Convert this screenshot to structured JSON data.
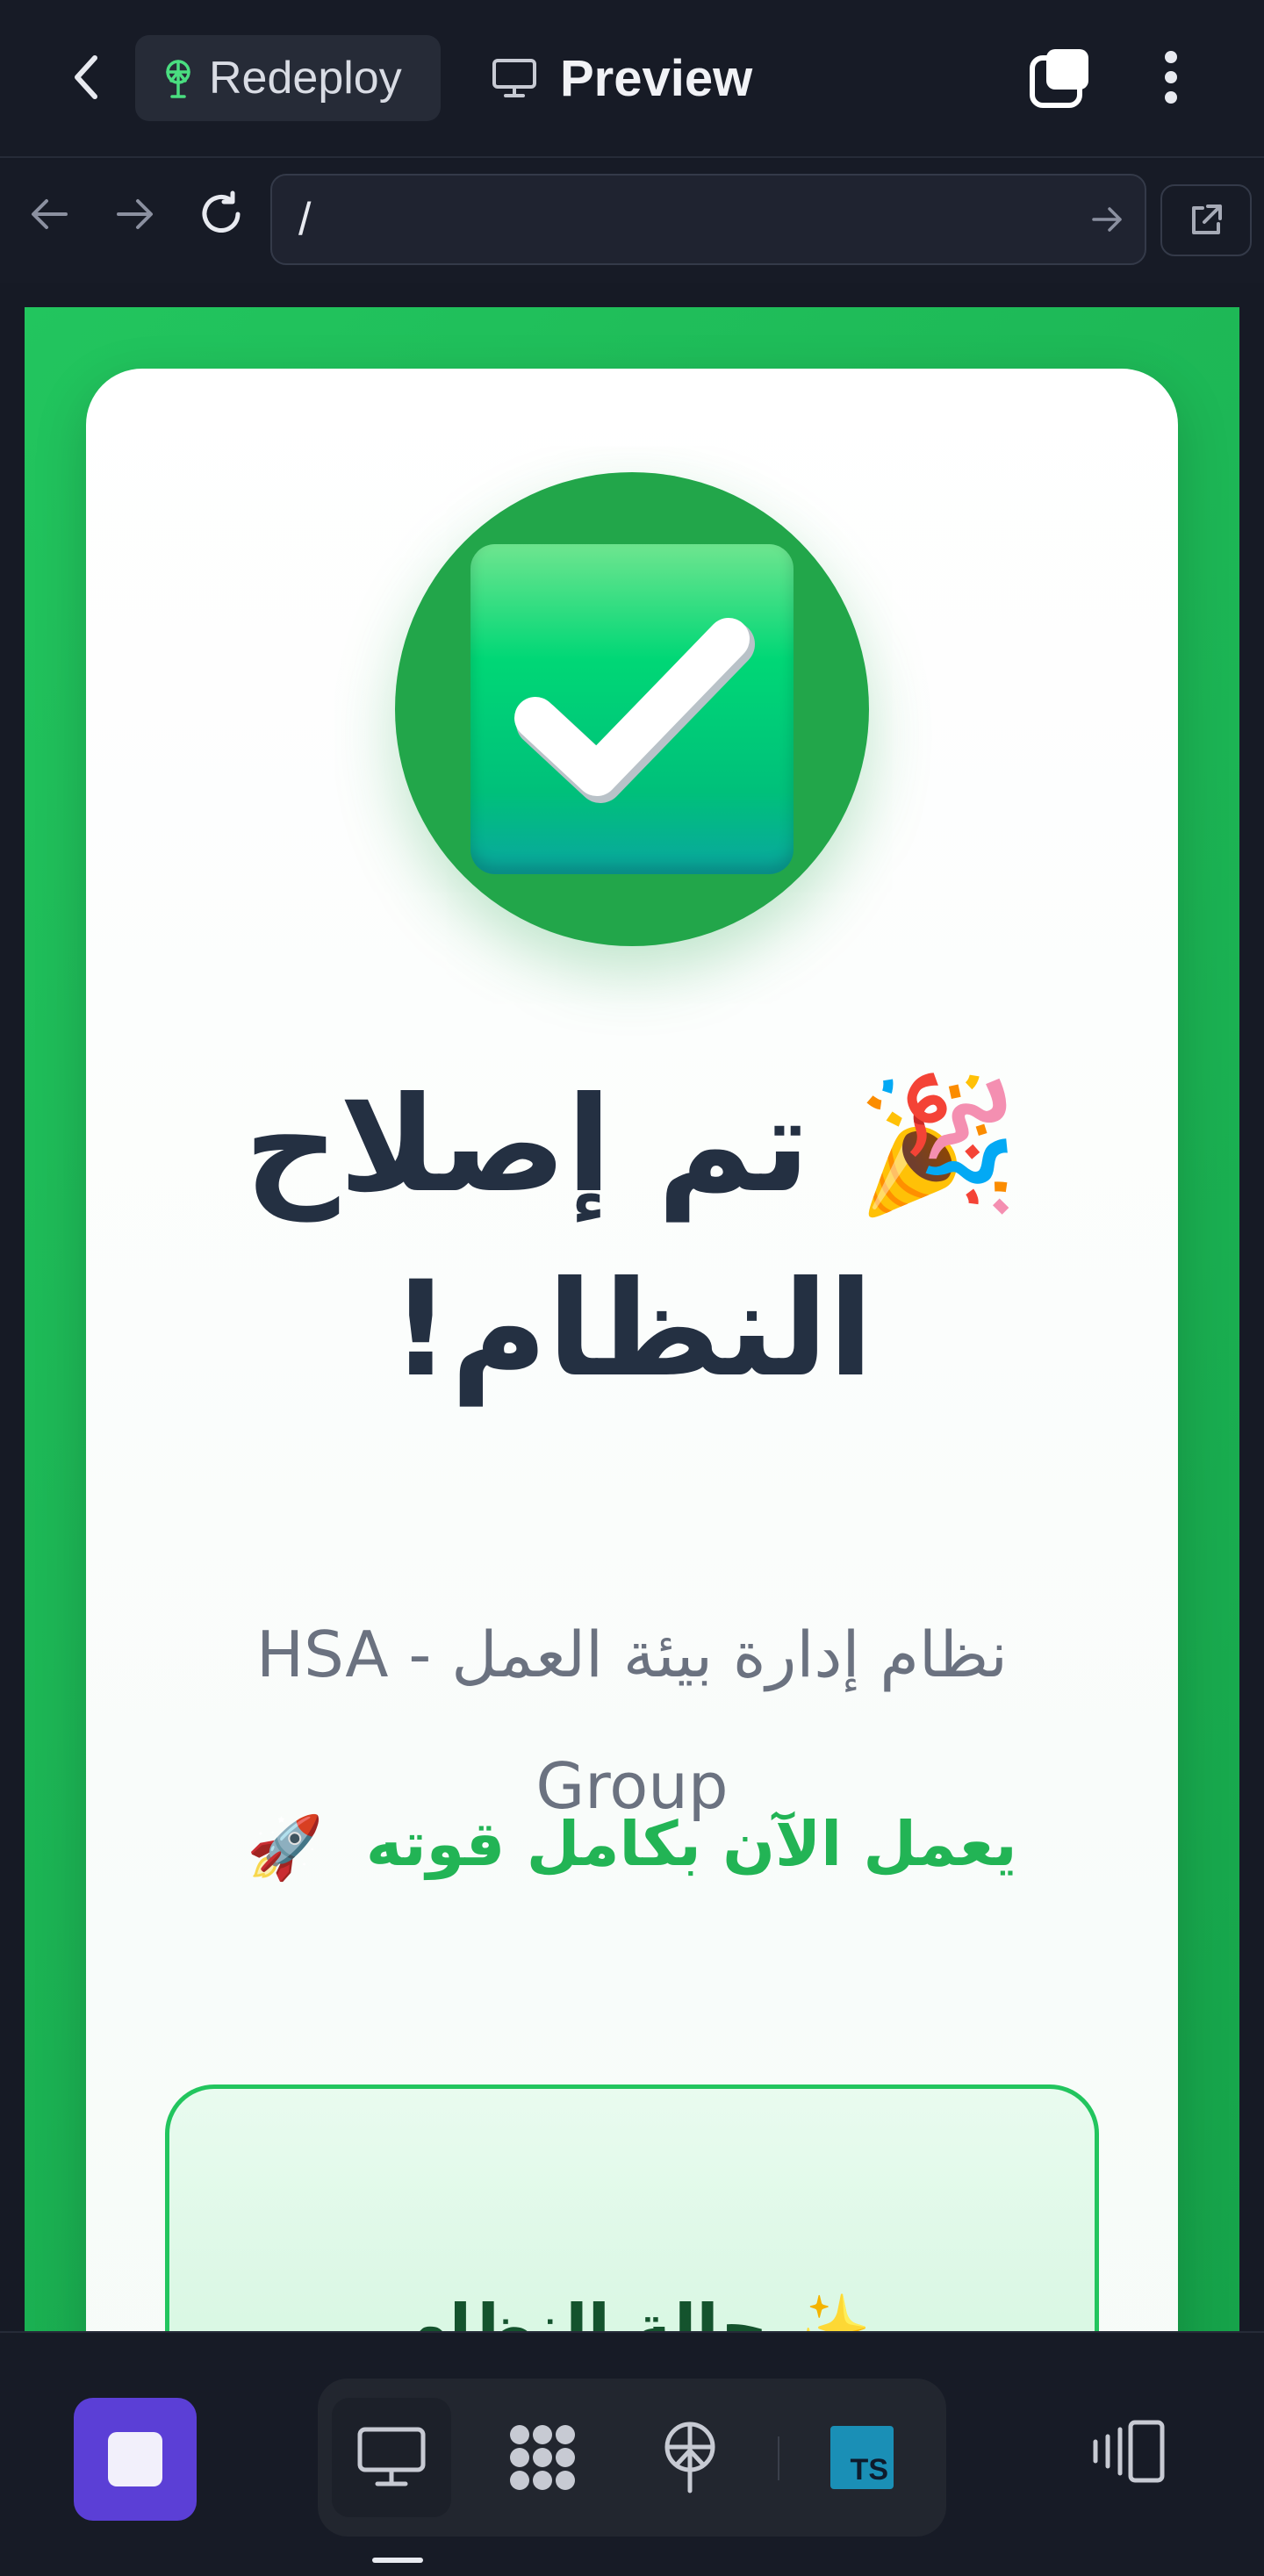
{
  "topbar": {
    "back_icon": "chevron-left-icon",
    "redeploy_label": "Redeploy",
    "redeploy_icon": "antenna-icon",
    "preview_label": "Preview",
    "preview_icon": "monitor-icon",
    "windows_icon": "stacked-windows-icon",
    "menu_icon": "kebab-menu-icon"
  },
  "browser": {
    "url": "/",
    "back_icon": "arrow-left-icon",
    "forward_icon": "arrow-right-icon",
    "reload_icon": "reload-icon",
    "external_icon": "external-link-icon"
  },
  "page": {
    "headline_line1": "🎉 تم إصلاح",
    "headline_line2": "النظام!",
    "subtitle": "نظام إدارة بيئة العمل - HSA Group",
    "tagline": "يعمل الآن بكامل قوته",
    "tagline_emoji": "🚀",
    "status_title": "✨ حالة النظام",
    "colors": {
      "background_green": "#22c55e",
      "card_bg": "#ffffff",
      "headline": "#243042",
      "subtitle": "#6b7280",
      "tagline": "#22b455"
    }
  },
  "bottombar": {
    "stop_icon": "stop-icon",
    "tools": [
      {
        "name": "desktop-icon",
        "active": true
      },
      {
        "name": "grid-apps-icon",
        "active": false
      },
      {
        "name": "antenna-icon",
        "active": false
      },
      {
        "name": "typescript-icon",
        "active": false
      }
    ],
    "ts_label": "TS",
    "devices_icon": "devices-icon"
  }
}
